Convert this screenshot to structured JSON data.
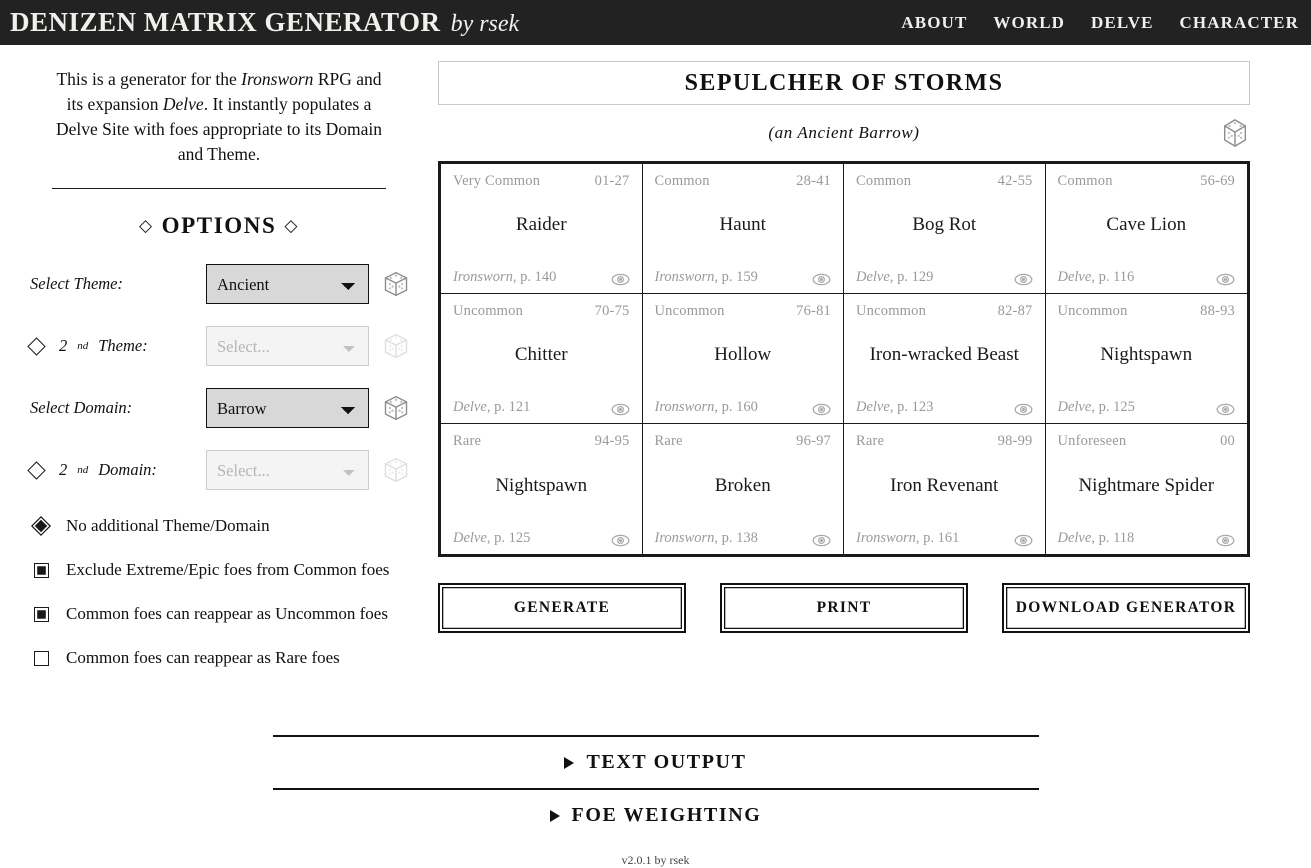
{
  "header": {
    "title": "DENIZEN MATRIX GENERATOR",
    "byline": "by rsek",
    "nav": [
      "ABOUT",
      "WORLD",
      "DELVE",
      "CHARACTER"
    ]
  },
  "sidebar": {
    "intro": {
      "part1": "This is a generator for the ",
      "em1": "Ironsworn",
      "part2": " RPG and its expansion ",
      "em2": "Delve",
      "part3": ". It instantly populates a Delve Site with foes appropriate to its Domain and Theme."
    },
    "options_heading": "OPTIONS",
    "diamond_glyph": "◇",
    "fields": [
      {
        "label": "Select Theme:",
        "sup": "",
        "has_diamond": false,
        "value": "Ancient",
        "enabled": true,
        "die_icon": "die-icon"
      },
      {
        "label": "Theme:",
        "prefix": "2",
        "sup": "nd",
        "has_diamond": true,
        "value": "Select...",
        "enabled": false,
        "die_icon": "die-icon"
      },
      {
        "label": "Select Domain:",
        "sup": "",
        "has_diamond": false,
        "value": "Barrow",
        "enabled": true,
        "die_icon": "die-icon"
      },
      {
        "label": "Domain:",
        "prefix": "2",
        "sup": "nd",
        "has_diamond": true,
        "value": "Select...",
        "enabled": false,
        "die_icon": "die-icon"
      }
    ],
    "toggles": [
      {
        "label": "No additional Theme/Domain",
        "type": "radio-diamond",
        "checked": true
      },
      {
        "label": "Exclude Extreme/Epic foes from Common foes",
        "type": "checkbox",
        "checked": true
      },
      {
        "label": "Common foes can reappear as Uncommon foes",
        "type": "checkbox",
        "checked": true
      },
      {
        "label": "Common foes can reappear as Rare foes",
        "type": "checkbox",
        "checked": false
      }
    ]
  },
  "main": {
    "site_title": "SEPULCHER OF STORMS",
    "site_subtitle": "(an Ancient Barrow)",
    "reroll_icon": "die-icon",
    "matrix": [
      {
        "rank": "Very Common",
        "range": "01-27",
        "name": "Raider",
        "source": "Ironsworn",
        "page": ", p. 140",
        "eye": "eye-icon"
      },
      {
        "rank": "Common",
        "range": "28-41",
        "name": "Haunt",
        "source": "Ironsworn",
        "page": ", p. 159",
        "eye": "eye-icon"
      },
      {
        "rank": "Common",
        "range": "42-55",
        "name": "Bog Rot",
        "source": "Delve",
        "page": ", p. 129",
        "eye": "eye-icon"
      },
      {
        "rank": "Common",
        "range": "56-69",
        "name": "Cave Lion",
        "source": "Delve",
        "page": ", p. 116",
        "eye": "eye-icon"
      },
      {
        "rank": "Uncommon",
        "range": "70-75",
        "name": "Chitter",
        "source": "Delve",
        "page": ", p. 121",
        "eye": "eye-icon"
      },
      {
        "rank": "Uncommon",
        "range": "76-81",
        "name": "Hollow",
        "source": "Ironsworn",
        "page": ", p. 160",
        "eye": "eye-icon"
      },
      {
        "rank": "Uncommon",
        "range": "82-87",
        "name": "Iron-wracked Beast",
        "source": "Delve",
        "page": ", p. 123",
        "eye": "eye-icon"
      },
      {
        "rank": "Uncommon",
        "range": "88-93",
        "name": "Nightspawn",
        "source": "Delve",
        "page": ", p. 125",
        "eye": "eye-icon"
      },
      {
        "rank": "Rare",
        "range": "94-95",
        "name": "Nightspawn",
        "source": "Delve",
        "page": ", p. 125",
        "eye": "eye-icon"
      },
      {
        "rank": "Rare",
        "range": "96-97",
        "name": "Broken",
        "source": "Ironsworn",
        "page": ", p. 138",
        "eye": "eye-icon"
      },
      {
        "rank": "Rare",
        "range": "98-99",
        "name": "Iron Revenant",
        "source": "Ironsworn",
        "page": ", p. 161",
        "eye": "eye-icon"
      },
      {
        "rank": "Unforeseen",
        "range": "00",
        "name": "Nightmare Spider",
        "source": "Delve",
        "page": ", p. 118",
        "eye": "eye-icon"
      }
    ],
    "buttons": [
      {
        "label": "GENERATE"
      },
      {
        "label": "PRINT"
      },
      {
        "label": "DOWNLOAD GENERATOR"
      }
    ],
    "accordions": [
      {
        "label": "TEXT OUTPUT"
      },
      {
        "label": "FOE WEIGHTING"
      }
    ]
  },
  "footer": {
    "version": "v2.0.1 by rsek"
  },
  "colors": {
    "topbar_bg": "#222222",
    "topbar_fg": "#f2f0ec",
    "ink": "#1a1a1a",
    "muted": "#999999",
    "select_bg": "#d8d8d8"
  }
}
